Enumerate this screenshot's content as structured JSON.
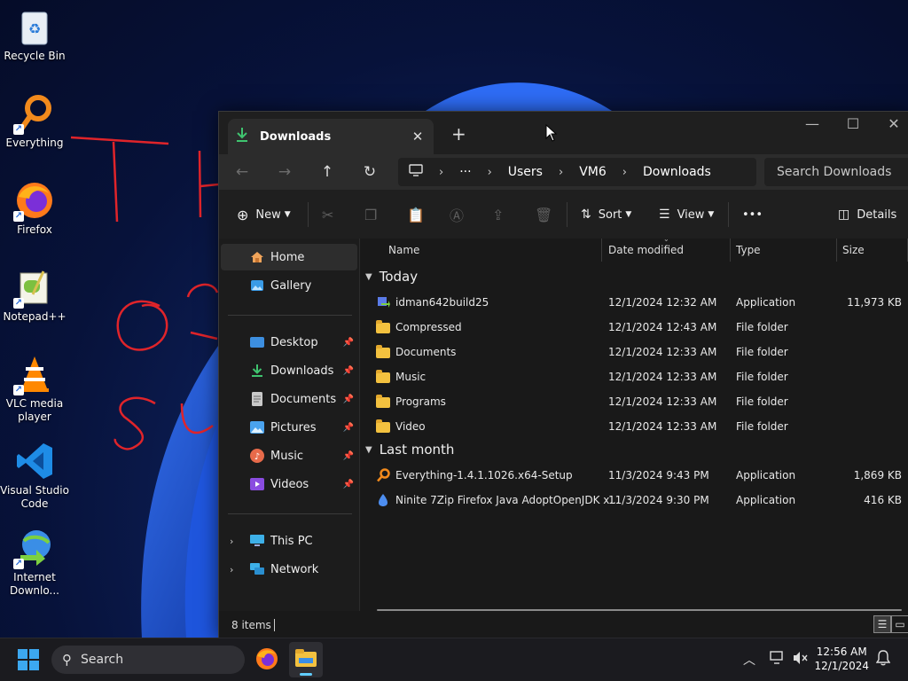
{
  "desktop": {
    "icons": [
      {
        "label": "Recycle Bin"
      },
      {
        "label": "Everything"
      },
      {
        "label": "Firefox"
      },
      {
        "label": "Notepad++"
      },
      {
        "label": "VLC media player"
      },
      {
        "label": "Visual Studio Code"
      },
      {
        "label": "Internet Downlo..."
      }
    ]
  },
  "window": {
    "tab_title": "Downloads",
    "tab_close": "✕",
    "new_tab": "+",
    "breadcrumb": {
      "more": "···",
      "items": [
        "Users",
        "VM6",
        "Downloads"
      ]
    },
    "search_placeholder": "Search Downloads",
    "toolbar": {
      "new_label": "New",
      "sort_label": "Sort",
      "view_label": "View",
      "more_label": "•••",
      "details_label": "Details"
    },
    "sidebar": {
      "top": [
        {
          "label": "Home",
          "icon": "home-icon",
          "selected": true
        },
        {
          "label": "Gallery",
          "icon": "gallery-icon"
        }
      ],
      "pinned": [
        {
          "label": "Desktop",
          "icon": "desktop-icon"
        },
        {
          "label": "Downloads",
          "icon": "download-icon"
        },
        {
          "label": "Documents",
          "icon": "documents-icon"
        },
        {
          "label": "Pictures",
          "icon": "pictures-icon"
        },
        {
          "label": "Music",
          "icon": "music-icon"
        },
        {
          "label": "Videos",
          "icon": "videos-icon"
        }
      ],
      "bottom": [
        {
          "label": "This PC",
          "icon": "this-pc-icon"
        },
        {
          "label": "Network",
          "icon": "network-icon"
        }
      ]
    },
    "columns": {
      "name": "Name",
      "date": "Date modified",
      "type": "Type",
      "size": "Size"
    },
    "groups": [
      {
        "label": "Today",
        "rows": [
          {
            "name": "idman642build25",
            "date": "12/1/2024 12:32 AM",
            "type": "Application",
            "size": "11,973 KB",
            "icon": "installer-icon"
          },
          {
            "name": "Compressed",
            "date": "12/1/2024 12:43 AM",
            "type": "File folder",
            "size": "",
            "icon": "folder-icon"
          },
          {
            "name": "Documents",
            "date": "12/1/2024 12:33 AM",
            "type": "File folder",
            "size": "",
            "icon": "folder-icon"
          },
          {
            "name": "Music",
            "date": "12/1/2024 12:33 AM",
            "type": "File folder",
            "size": "",
            "icon": "folder-icon"
          },
          {
            "name": "Programs",
            "date": "12/1/2024 12:33 AM",
            "type": "File folder",
            "size": "",
            "icon": "folder-icon"
          },
          {
            "name": "Video",
            "date": "12/1/2024 12:33 AM",
            "type": "File folder",
            "size": "",
            "icon": "folder-icon"
          }
        ]
      },
      {
        "label": "Last month",
        "rows": [
          {
            "name": "Everything-1.4.1.1026.x64-Setup",
            "date": "11/3/2024 9:43 PM",
            "type": "Application",
            "size": "1,869 KB",
            "icon": "everything-icon"
          },
          {
            "name": "Ninite 7Zip Firefox Java AdoptOpenJDK x...",
            "date": "11/3/2024 9:30 PM",
            "type": "Application",
            "size": "416 KB",
            "icon": "ninite-icon"
          }
        ]
      }
    ],
    "status": {
      "count": "8 items"
    }
  },
  "taskbar": {
    "search_label": "Search",
    "time": "12:56 AM",
    "date": "12/1/2024"
  }
}
